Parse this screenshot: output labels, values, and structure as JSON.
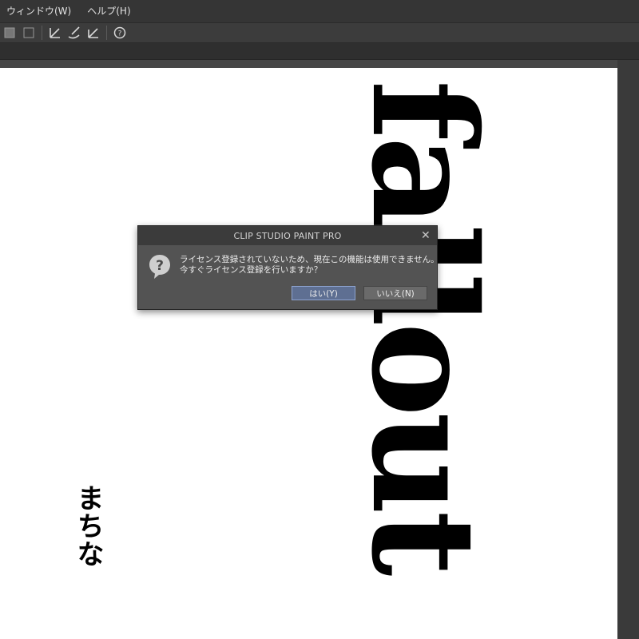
{
  "menubar": {
    "items": [
      "ウィンドウ(W)",
      "ヘルプ(H)"
    ]
  },
  "toolbar": {
    "icons": [
      "snap-icon",
      "fill-icon",
      "ruler-snap-icon",
      "brush-icon",
      "pen-ruler-icon",
      "refresh-help-icon"
    ]
  },
  "canvas": {
    "vertical_text": "fallout",
    "japanese_text": "まちな"
  },
  "dialog": {
    "title": "CLIP STUDIO PAINT PRO",
    "message_line1": "ライセンス登録されていないため、現在この機能は使用できません。",
    "message_line2": "今すぐライセンス登録を行いますか？",
    "yes_label": "はい(Y)",
    "no_label": "いいえ(N)",
    "close_label": "✕"
  },
  "colors": {
    "menubar": "#353535",
    "dialog_bg": "#535353",
    "primary_button": "#5e6f92"
  }
}
